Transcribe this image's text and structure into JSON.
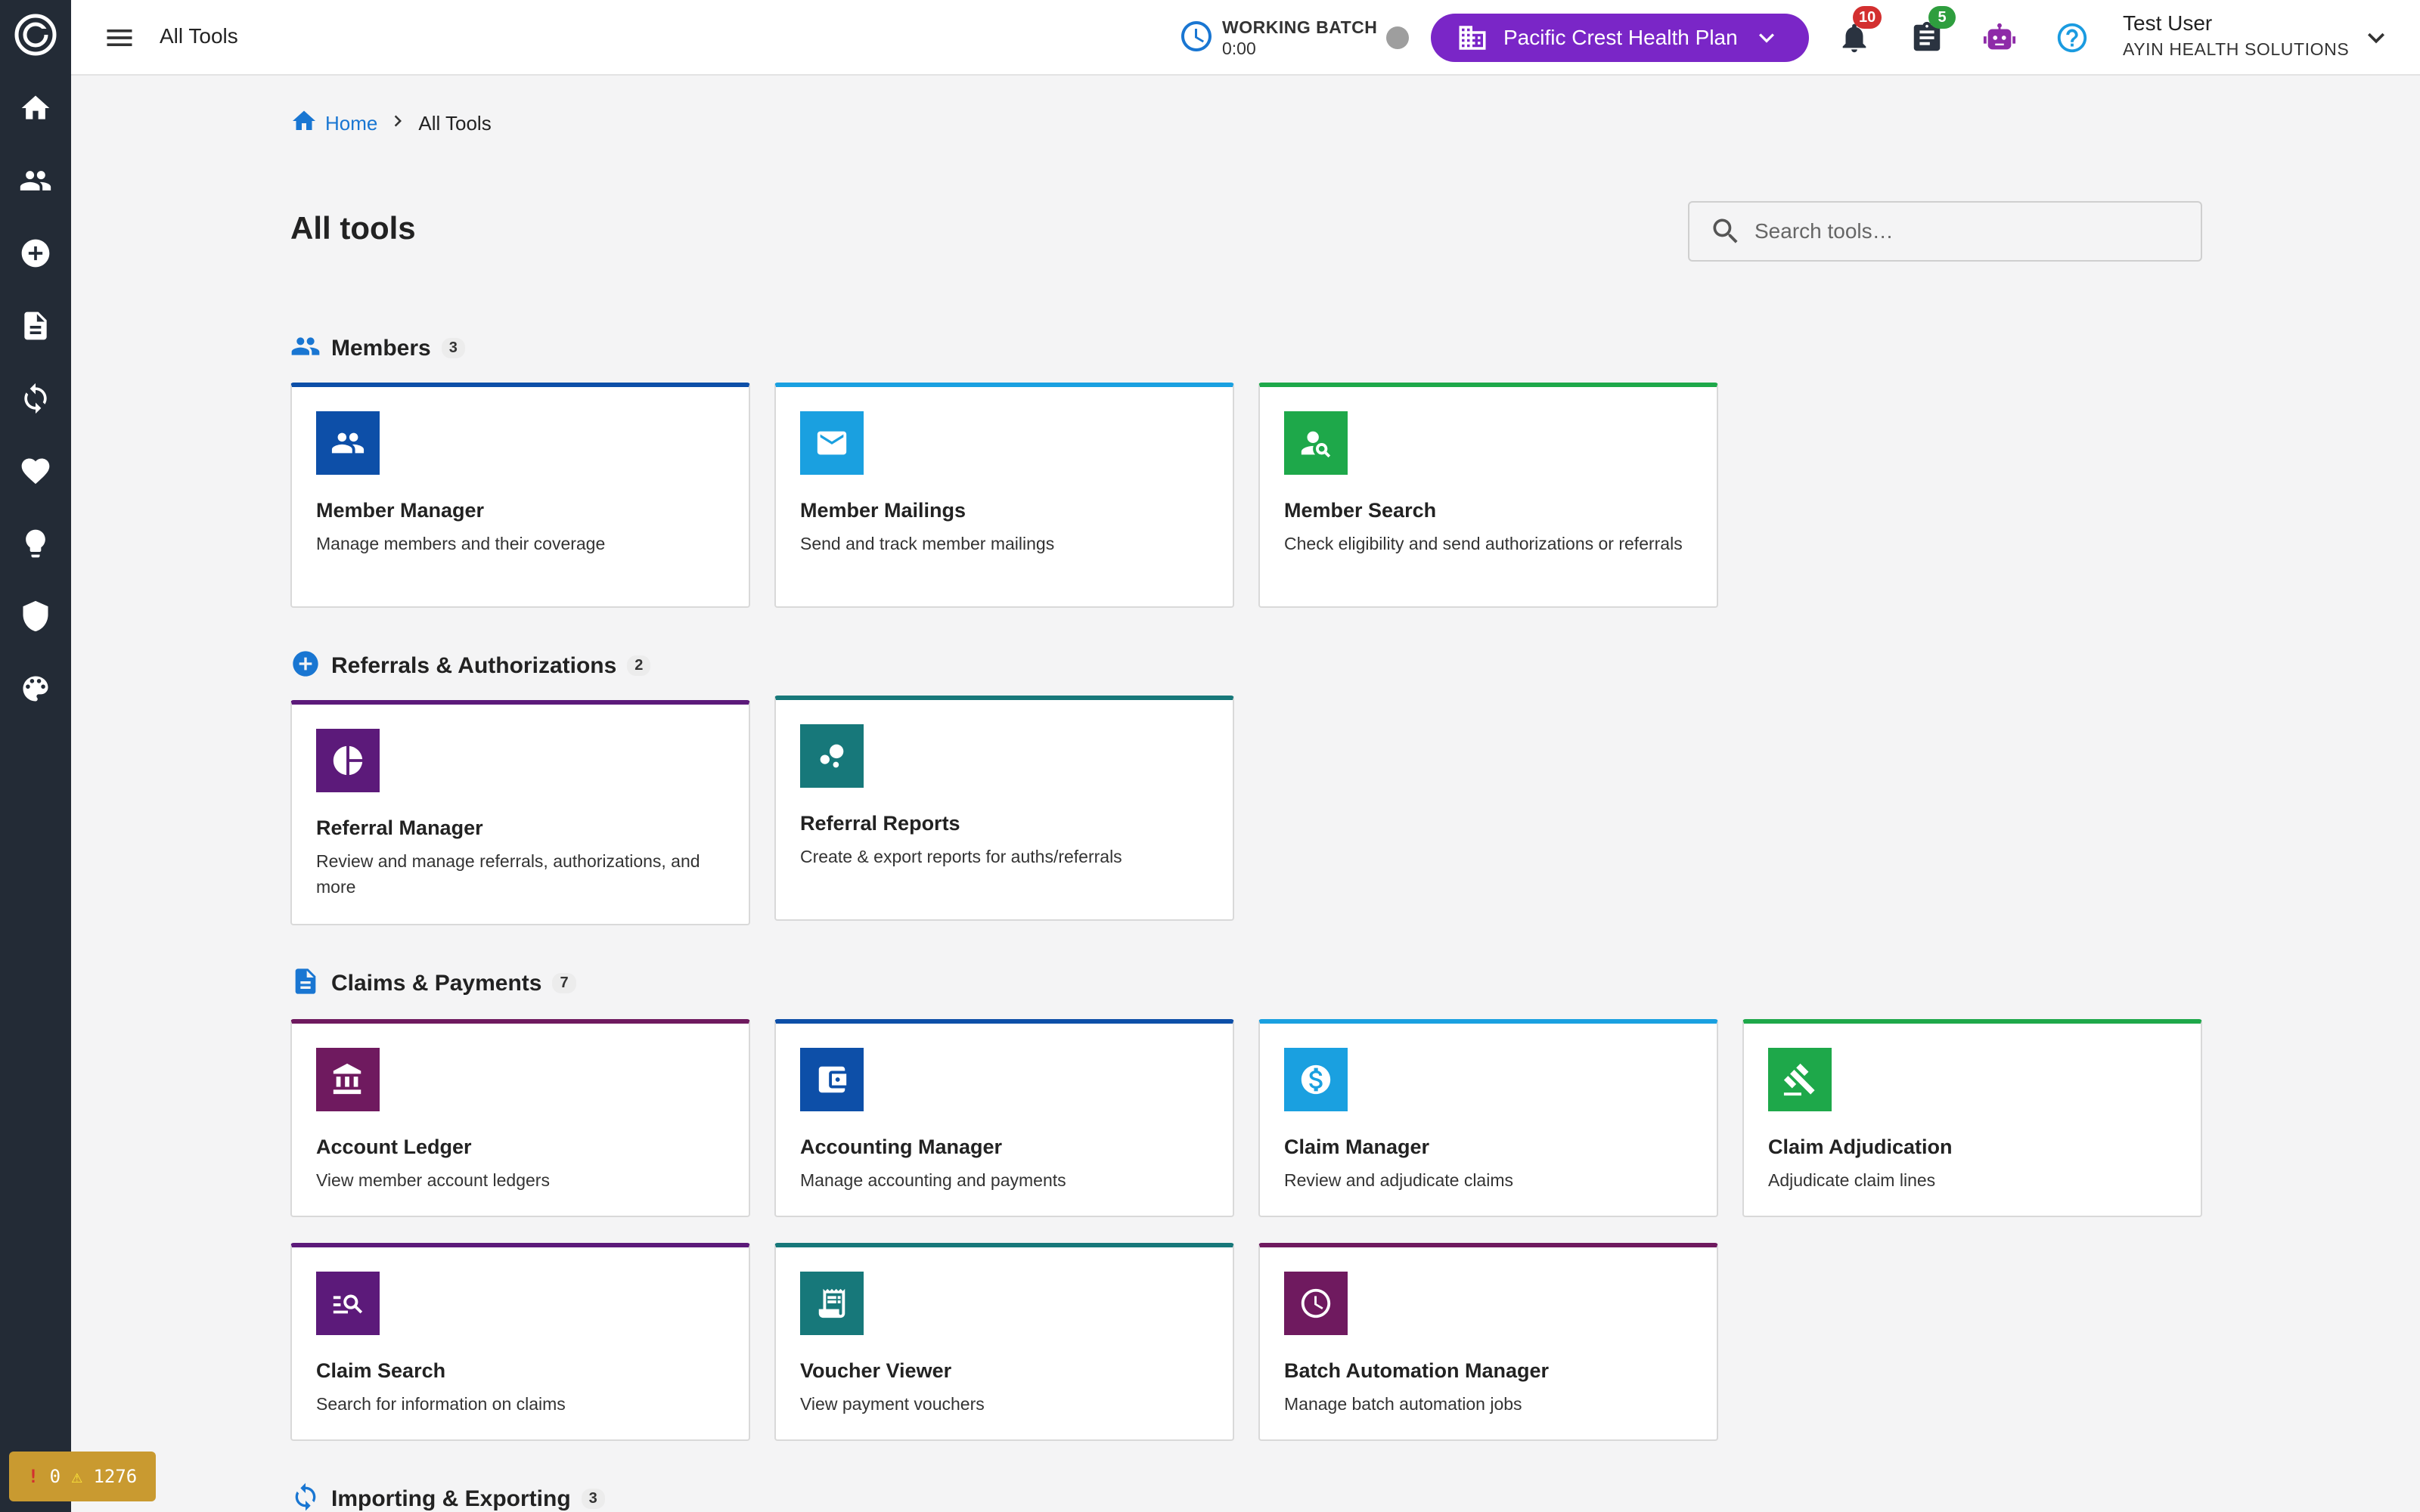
{
  "header": {
    "title": "All Tools",
    "batch_label": "WORKING BATCH",
    "batch_time": "0:00",
    "plan": "Pacific Crest Health Plan",
    "notifications_count": "10",
    "tasks_count": "5",
    "user_name": "Test User",
    "user_org": "AYIN HEALTH SOLUTIONS"
  },
  "breadcrumb": {
    "home": "Home",
    "current": "All Tools"
  },
  "page": {
    "title": "All tools"
  },
  "search": {
    "placeholder": "Search tools…"
  },
  "sections": [
    {
      "title": "Members",
      "count": "3",
      "icon": "people-icon",
      "cards": [
        {
          "title": "Member Manager",
          "desc": "Manage members and their coverage",
          "icon": "people-icon",
          "color": "#0d4fa8"
        },
        {
          "title": "Member Mailings",
          "desc": "Send and track member mailings",
          "icon": "mail-icon",
          "color": "#1aa0e0"
        },
        {
          "title": "Member Search",
          "desc": "Check eligibility and send authorizations or referrals",
          "icon": "person-search-icon",
          "color": "#1ea84a"
        }
      ]
    },
    {
      "title": "Referrals & Authorizations",
      "count": "2",
      "icon": "add-circle-icon",
      "cards": [
        {
          "title": "Referral Manager",
          "desc": "Review and manage referrals, authorizations, and more",
          "icon": "pie-chart-icon",
          "color": "#5c1a7a"
        },
        {
          "title": "Referral Reports",
          "desc": "Create & export reports for auths/referrals",
          "icon": "bubble-chart-icon",
          "color": "#17787a"
        }
      ]
    },
    {
      "title": "Claims & Payments",
      "count": "7",
      "icon": "document-icon",
      "cards": [
        {
          "title": "Account Ledger",
          "desc": "View member account ledgers",
          "icon": "bank-icon",
          "color": "#6f1a5f"
        },
        {
          "title": "Accounting Manager",
          "desc": "Manage accounting and payments",
          "icon": "wallet-icon",
          "color": "#0d4fa8"
        },
        {
          "title": "Claim Manager",
          "desc": "Review and adjudicate claims",
          "icon": "dollar-icon",
          "color": "#1aa0e0"
        },
        {
          "title": "Claim Adjudication",
          "desc": "Adjudicate claim lines",
          "icon": "gavel-icon",
          "color": "#1ea84a"
        },
        {
          "title": "Claim Search",
          "desc": "Search for information on claims",
          "icon": "manage-search-icon",
          "color": "#5c1a7a"
        },
        {
          "title": "Voucher Viewer",
          "desc": "View payment vouchers",
          "icon": "receipt-icon",
          "color": "#17787a"
        },
        {
          "title": "Batch Automation Manager",
          "desc": "Manage batch automation jobs",
          "icon": "clock-icon",
          "color": "#6f1a5f"
        }
      ]
    },
    {
      "title": "Importing & Exporting",
      "count": "3",
      "icon": "sync-icon"
    }
  ],
  "devbar": {
    "errors": "0",
    "warnings": "1276"
  },
  "colors": {
    "sidebar": "#232b36",
    "accent": "#1976d2",
    "plan": "#7a26c7",
    "notif_badge": "#d32f2f",
    "task_badge": "#2e9e3e"
  }
}
